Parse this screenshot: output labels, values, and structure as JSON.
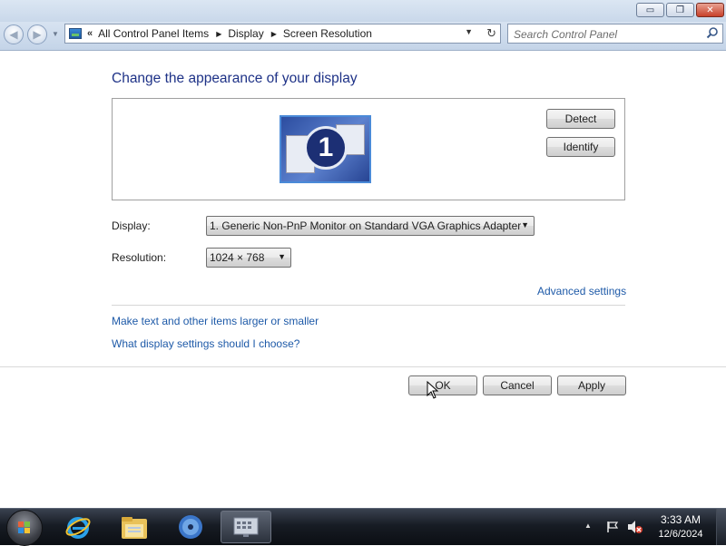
{
  "window": {
    "caption_buttons": {
      "minimize": "▭",
      "maximize": "❐",
      "close": "✕"
    }
  },
  "navigation": {
    "back": "◀",
    "forward": "▶",
    "address": {
      "overflow": "«",
      "crumbs": [
        "All Control Panel Items",
        "Display",
        "Screen Resolution"
      ],
      "separator": "▶",
      "dropdown": "▼",
      "refresh": "↻"
    },
    "search": {
      "placeholder": "Search Control Panel"
    }
  },
  "content": {
    "heading": "Change the appearance of your display",
    "monitor_number": "1",
    "detect_label": "Detect",
    "identify_label": "Identify",
    "display_label": "Display:",
    "display_value": "1. Generic Non-PnP Monitor on Standard VGA Graphics Adapter",
    "resolution_label": "Resolution:",
    "resolution_value": "1024 × 768",
    "advanced_link": "Advanced settings",
    "textsize_link": "Make text and other items larger or smaller",
    "help_link": "What display settings should I choose?",
    "ok_label": "OK",
    "cancel_label": "Cancel",
    "apply_label": "Apply"
  },
  "taskbar": {
    "clock_time": "3:33 AM",
    "clock_date": "12/6/2024",
    "tray_arrow": "▲",
    "icons": [
      "start-orb-icon",
      "internet-explorer-icon",
      "windows-explorer-icon",
      "media-player-icon",
      "display-settings-icon"
    ]
  },
  "colors": {
    "heading": "#1e3287",
    "link": "#1e5aa8",
    "taskbar": "#171c24"
  }
}
